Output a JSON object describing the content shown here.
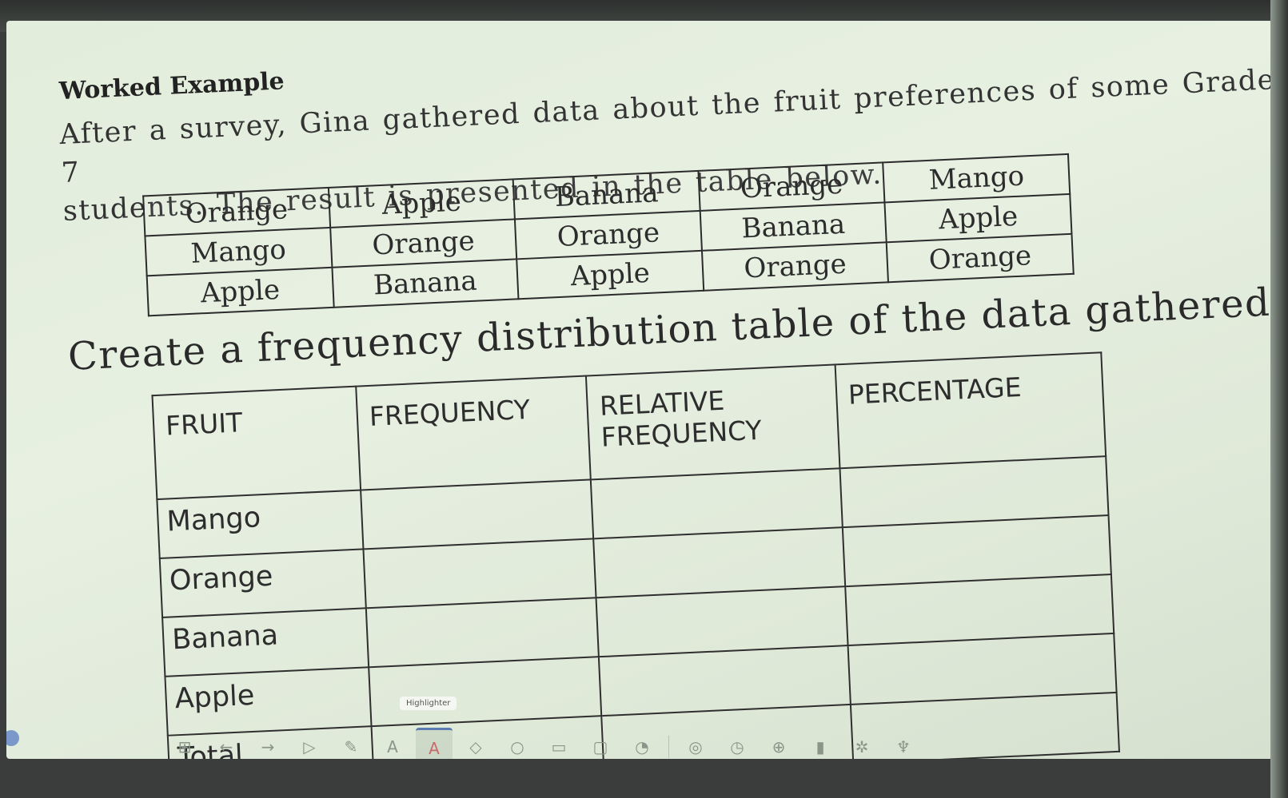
{
  "heading": "Worked Example",
  "intro_lines": [
    "After a survey, Gina gathered data about the fruit preferences of some Grade 7",
    "students. The result is presented in the table below."
  ],
  "survey_rows": [
    [
      "Orange",
      "Apple",
      "Banana",
      "Orange",
      "Mango"
    ],
    [
      "Mango",
      "Orange",
      "Orange",
      "Banana",
      "Apple"
    ],
    [
      "Apple",
      "Banana",
      "Apple",
      "Orange",
      "Orange"
    ]
  ],
  "prompt": "Create a frequency distribution table of the data gathered.",
  "freq_table": {
    "headers": [
      "FRUIT",
      "FREQUENCY",
      "RELATIVE FREQUENCY",
      "PERCENTAGE"
    ],
    "rows": [
      "Mango",
      "Orange",
      "Banana",
      "Apple",
      "Total"
    ]
  },
  "tooltip": "Highlighter",
  "toolbar": {
    "items": [
      "grid-icon",
      "undo-icon",
      "redo-icon",
      "select-icon",
      "pen-icon",
      "text-a-icon",
      "highlight-a-icon",
      "eraser-icon",
      "shapes-icon",
      "textbox-icon",
      "comment-icon",
      "timer-hand-icon",
      "ai-icon",
      "clock-icon",
      "web-icon",
      "chart-icon",
      "spinner-icon",
      "trophy-icon"
    ]
  }
}
